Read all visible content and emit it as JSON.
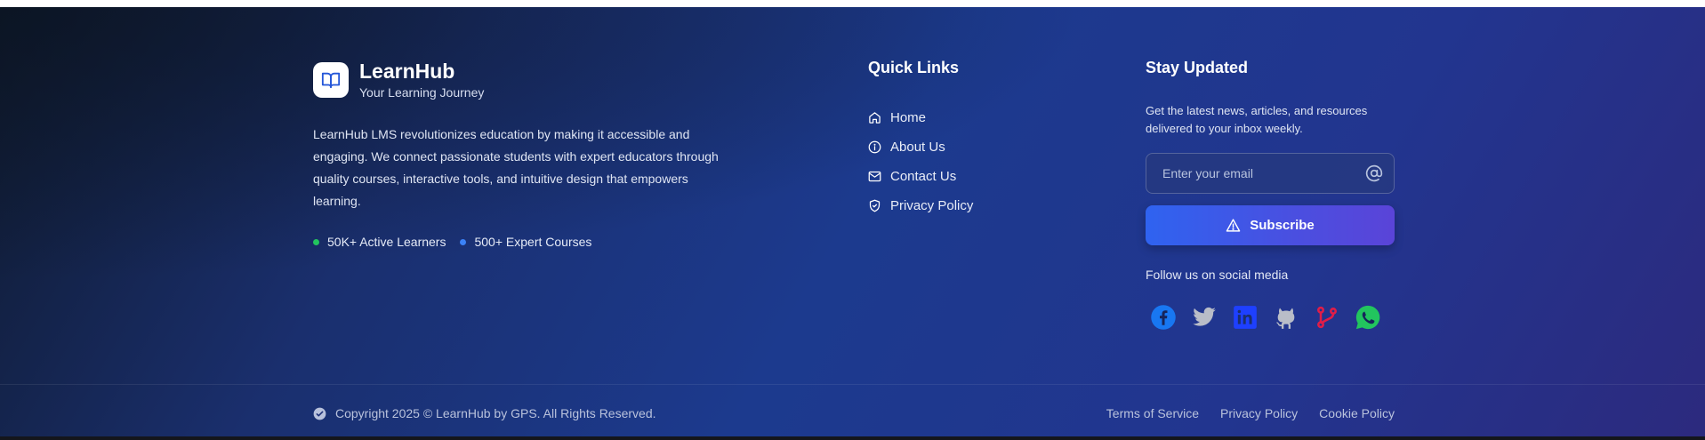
{
  "brand": {
    "name": "LearnHub",
    "tagline": "Your Learning Journey",
    "description": "LearnHub LMS revolutionizes education by making it accessible and engaging. We connect passionate students with expert educators through quality courses, interactive tools, and intuitive design that empowers learning.",
    "stats": [
      {
        "label": "50K+ Active Learners",
        "color": "#22c55e"
      },
      {
        "label": "500+ Expert Courses",
        "color": "#3b82f6"
      }
    ]
  },
  "quick_links": {
    "title": "Quick Links",
    "items": [
      {
        "label": "Home",
        "icon": "home-icon"
      },
      {
        "label": "About Us",
        "icon": "info-icon"
      },
      {
        "label": "Contact Us",
        "icon": "mail-icon"
      },
      {
        "label": "Privacy Policy",
        "icon": "shield-icon"
      }
    ]
  },
  "newsletter": {
    "title": "Stay Updated",
    "description": "Get the latest news, articles, and resources delivered to your inbox weekly.",
    "email_placeholder": "Enter your email",
    "subscribe_label": "Subscribe",
    "follow_label": "Follow us on social media",
    "socials": [
      {
        "icon": "facebook-icon",
        "color": "#1877f2"
      },
      {
        "icon": "twitter-icon",
        "color": "#b9bdc8"
      },
      {
        "icon": "linkedin-icon",
        "color": "#1e40ff"
      },
      {
        "icon": "github-icon",
        "color": "#b9bdc8"
      },
      {
        "icon": "git-branch-icon",
        "color": "#e11d48"
      },
      {
        "icon": "whatsapp-icon",
        "color": "#22c55e"
      }
    ]
  },
  "bottom_bar": {
    "copyright": "Copyright 2025 © LearnHub by GPS. All Rights Reserved.",
    "links": [
      "Terms of Service",
      "Privacy Policy",
      "Cookie Policy"
    ]
  },
  "colors": {
    "accent": "#2f63f0",
    "accent_end": "#5a44d8"
  }
}
